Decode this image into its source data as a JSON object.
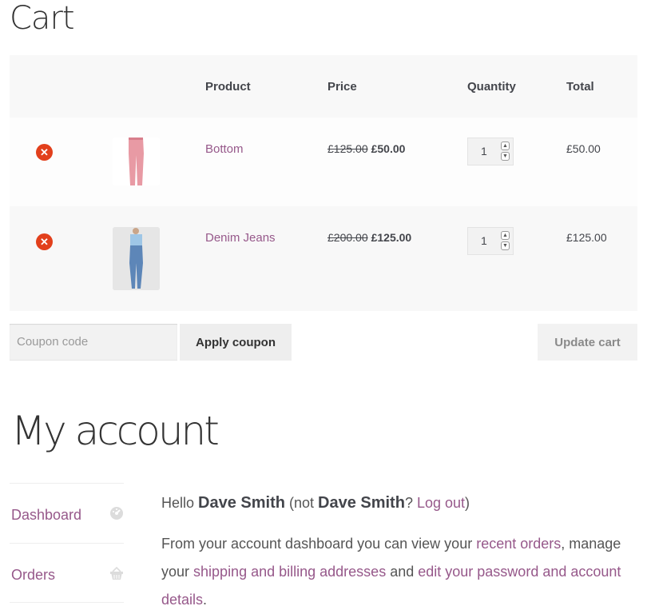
{
  "cart": {
    "title": "Cart",
    "headers": {
      "product": "Product",
      "price": "Price",
      "quantity": "Quantity",
      "total": "Total"
    },
    "items": [
      {
        "remove_icon": "remove-icon",
        "name": "Bottom",
        "old_price": "£125.00",
        "new_price": "£50.00",
        "quantity": "1",
        "total": "£50.00"
      },
      {
        "remove_icon": "remove-icon",
        "name": "Denim Jeans",
        "old_price": "£200.00",
        "new_price": "£125.00",
        "quantity": "1",
        "total": "£125.00"
      }
    ],
    "coupon_placeholder": "Coupon code",
    "apply_label": "Apply coupon",
    "update_label": "Update cart"
  },
  "account": {
    "title": "My account",
    "nav": [
      {
        "label": "Dashboard",
        "icon": "dashboard-icon"
      },
      {
        "label": "Orders",
        "icon": "basket-icon"
      }
    ],
    "greeting": {
      "hello": "Hello ",
      "name": "Dave Smith",
      "not_open": " (not ",
      "name2": "Dave Smith",
      "q": "? ",
      "logout": "Log out",
      "close": ")"
    },
    "dashboard_text": {
      "part1": "From your account dashboard you can view your ",
      "link1": "recent orders",
      "part2": ", manage your ",
      "link2": "shipping and billing addresses",
      "part3": " and ",
      "link3": "edit your password and account details",
      "part4": "."
    }
  },
  "colors": {
    "link": "#96588a",
    "remove": "#e2401c",
    "text": "#43454b"
  }
}
